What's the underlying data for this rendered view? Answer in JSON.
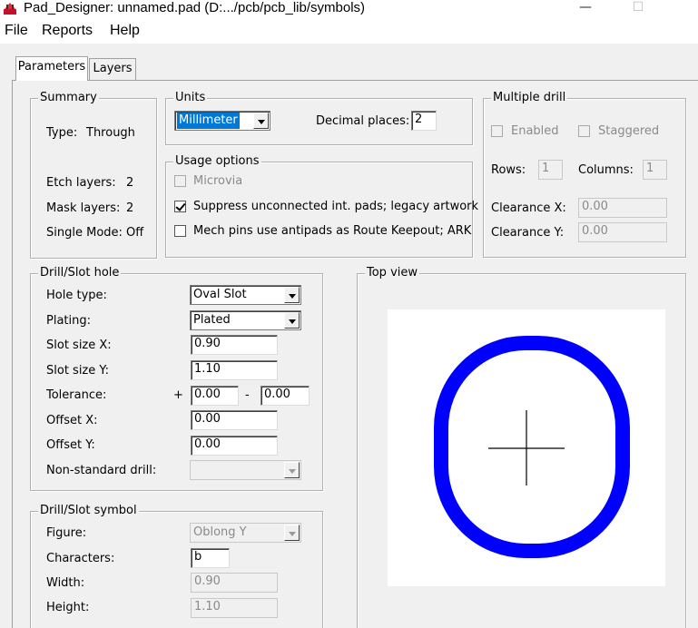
{
  "window": {
    "title": "Pad_Designer: unnamed.pad (D:.../pcb/pcb_lib/symbols)",
    "minimize_glyph": "—",
    "maximize_glyph": "☐"
  },
  "menu": [
    "File",
    "Reports",
    "Help"
  ],
  "tabs": [
    "Parameters",
    "Layers"
  ],
  "summary": {
    "title": "Summary",
    "type_label": "Type:",
    "type_value": "Through",
    "etch_label": "Etch layers:",
    "etch_value": "2",
    "mask_label": "Mask layers:",
    "mask_value": "2",
    "single_label": "Single Mode:",
    "single_value": "Off"
  },
  "units": {
    "title": "Units",
    "selected": "Millimeter",
    "decimal_label": "Decimal places:",
    "decimal_value": "2"
  },
  "usage": {
    "title": "Usage options",
    "microvia": "Microvia",
    "suppress": "Suppress unconnected int. pads; legacy artwork",
    "mech": "Mech pins use antipads as Route Keepout; ARK"
  },
  "multi_drill": {
    "title": "Multiple drill",
    "enabled": "Enabled",
    "staggered": "Staggered",
    "rows_label": "Rows:",
    "rows_value": "1",
    "columns_label": "Columns:",
    "columns_value": "1",
    "clearance_x_label": "Clearance X:",
    "clearance_x_value": "0.00",
    "clearance_y_label": "Clearance Y:",
    "clearance_y_value": "0.00"
  },
  "drill": {
    "title": "Drill/Slot hole",
    "hole_type_label": "Hole type:",
    "hole_type_value": "Oval Slot",
    "plating_label": "Plating:",
    "plating_value": "Plated",
    "slot_x_label": "Slot size X:",
    "slot_x_value": "0.90",
    "slot_y_label": "Slot size Y:",
    "slot_y_value": "1.10",
    "tolerance_label": "Tolerance:",
    "tol_plus_sign": "+",
    "tol_plus_value": "0.00",
    "tol_minus_sign": "-",
    "tol_minus_value": "0.00",
    "offset_x_label": "Offset X:",
    "offset_x_value": "0.00",
    "offset_y_label": "Offset Y:",
    "offset_y_value": "0.00",
    "nonstd_label": "Non-standard drill:",
    "nonstd_value": ""
  },
  "symbol": {
    "title": "Drill/Slot symbol",
    "figure_label": "Figure:",
    "figure_value": "Oblong Y",
    "chars_label": "Characters:",
    "chars_value": "b",
    "width_label": "Width:",
    "width_value": "0.90",
    "height_label": "Height:",
    "height_value": "1.10"
  },
  "top_view": {
    "title": "Top view",
    "pad_color": "#0000ff",
    "crosshair_color": "#000000"
  }
}
